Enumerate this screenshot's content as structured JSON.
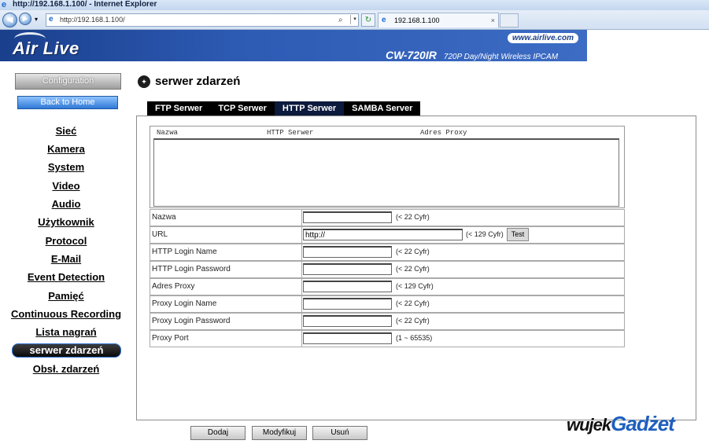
{
  "window": {
    "title": "http://192.168.1.100/ - Internet Explorer",
    "address": "http://192.168.1.100/",
    "tab_label": "192.168.1.100",
    "tab_close": "×",
    "search_glyph": "⌕",
    "dropdown_glyph": "▾"
  },
  "banner": {
    "brand": "Air Live",
    "site": "www.airlive.com",
    "model": "CW-720IR",
    "model_desc": "720P Day/Night Wireless IPCAM"
  },
  "sidebar": {
    "config_button": "Configuration",
    "home_button": "Back to Home",
    "items": [
      {
        "label": "Sieć"
      },
      {
        "label": "Kamera"
      },
      {
        "label": "System"
      },
      {
        "label": "Video"
      },
      {
        "label": "Audio"
      },
      {
        "label": "Użytkownik"
      },
      {
        "label": "Protocol"
      },
      {
        "label": "E-Mail"
      },
      {
        "label": "Event Detection"
      },
      {
        "label": "Pamięć"
      },
      {
        "label": "Continuous Recording"
      },
      {
        "label": "Lista nagrań"
      },
      {
        "label": "serwer zdarzeń",
        "active": true
      },
      {
        "label": "Obsł. zdarzeń"
      }
    ]
  },
  "main": {
    "title": "serwer zdarzeń",
    "tabs": [
      {
        "label": "FTP Serwer"
      },
      {
        "label": "TCP Serwer"
      },
      {
        "label": "HTTP Serwer",
        "selected": true
      },
      {
        "label": "SAMBA Server"
      }
    ],
    "list_headers": [
      "Nazwa",
      "HTTP Serwer",
      "Adres Proxy"
    ],
    "fields": [
      {
        "label": "Nazwa",
        "value": "",
        "hint": "(< 22 Cyfr)"
      },
      {
        "label": "URL",
        "value": "http://",
        "hint": "(< 129 Cyfr)",
        "button": "Test"
      },
      {
        "label": "HTTP Login Name",
        "value": "",
        "hint": "(< 22 Cyfr)"
      },
      {
        "label": "HTTP Login Password",
        "value": "",
        "hint": "(< 22 Cyfr)"
      },
      {
        "label": "Adres Proxy",
        "value": "",
        "hint": "(< 129 Cyfr)"
      },
      {
        "label": "Proxy Login Name",
        "value": "",
        "hint": "(< 22 Cyfr)"
      },
      {
        "label": "Proxy Login Password",
        "value": "",
        "hint": "(< 22 Cyfr)"
      },
      {
        "label": "Proxy Port",
        "value": "",
        "hint": "(1 ~ 65535)"
      }
    ],
    "actions": {
      "add": "Dodaj",
      "modify": "Modyfikuj",
      "delete": "Usuń"
    }
  },
  "watermark": {
    "part1": "wujek",
    "part2": "Gadżet"
  },
  "colors": {
    "banner": "#2d5ab3",
    "active_menu": "#0a0a0a",
    "tab_bar": "#000000"
  }
}
